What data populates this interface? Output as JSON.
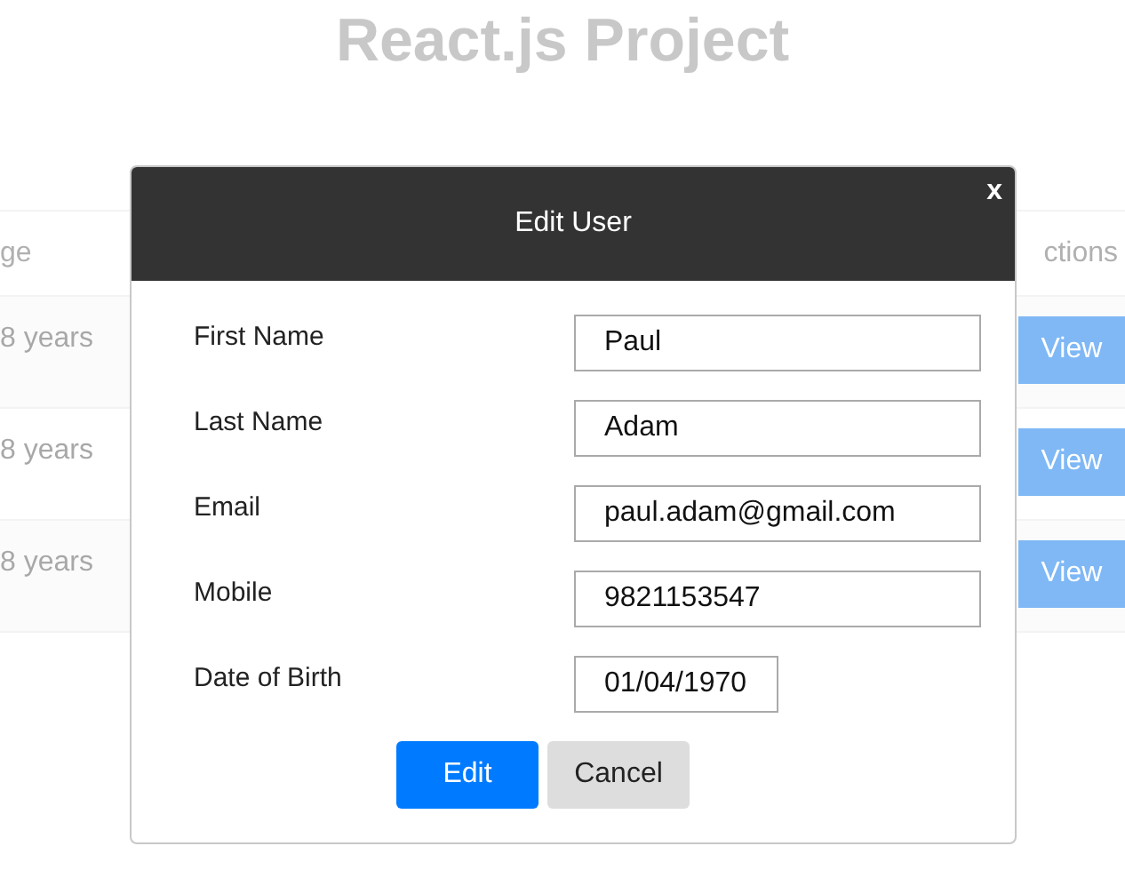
{
  "page_title": "React.js Project",
  "table": {
    "columns": [
      "ge",
      "ctions"
    ],
    "rows": [
      {
        "column_1": "8 years",
        "action": "View"
      },
      {
        "column_1": "8 years",
        "action": "View"
      },
      {
        "column_1": "8 years",
        "action": "View"
      }
    ]
  },
  "modal": {
    "title": "Edit User",
    "close": "x",
    "fields": [
      {
        "label": "First Name",
        "value": "Paul",
        "kind": "text"
      },
      {
        "label": "Last Name",
        "value": "Adam",
        "kind": "text"
      },
      {
        "label": "Email",
        "value": "paul.adam@gmail.com",
        "kind": "text"
      },
      {
        "label": "Mobile",
        "value": "9821153547",
        "kind": "text"
      },
      {
        "label": "Date of Birth",
        "value": "01/04/1970",
        "kind": "date"
      }
    ],
    "buttons": [
      {
        "label": "Edit",
        "kind": "primary"
      },
      {
        "label": "Cancel",
        "kind": "secondary"
      }
    ]
  }
}
